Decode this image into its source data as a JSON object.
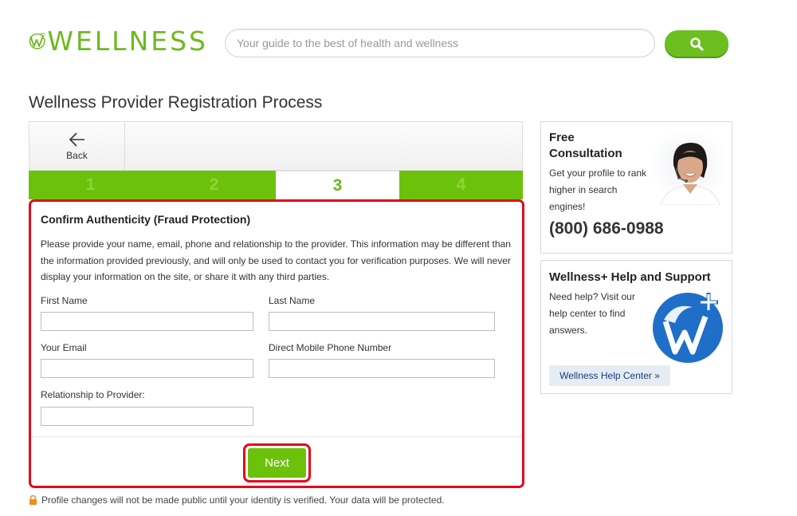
{
  "header": {
    "logo_text": "WELLNESS",
    "search": {
      "placeholder": "Your guide to the best of health and wellness",
      "value": ""
    },
    "search_icon": "search-icon"
  },
  "page_title": "Wellness Provider Registration Process",
  "nav": {
    "back_label": "Back",
    "back_icon": "arrow-left-icon"
  },
  "steps": [
    {
      "label": "1",
      "active": false
    },
    {
      "label": "2",
      "active": false
    },
    {
      "label": "3",
      "active": true
    },
    {
      "label": "4",
      "active": false
    }
  ],
  "form": {
    "title": "Confirm Authenticity (Fraud Protection)",
    "description": "Please provide your name, email, phone and relationship to the provider. This information may be different than the information provided previously, and will only be used to contact you for verification purposes. We will never display your information on the site, or share it with any third parties.",
    "fields": {
      "first_name": {
        "label": "First Name",
        "value": ""
      },
      "last_name": {
        "label": "Last Name",
        "value": ""
      },
      "email": {
        "label": "Your Email",
        "value": ""
      },
      "phone": {
        "label": "Direct Mobile Phone Number",
        "value": ""
      },
      "relationship": {
        "label": "Relationship to Provider:",
        "value": ""
      }
    },
    "next_label": "Next"
  },
  "privacy_note": "Profile changes will not be made public until your identity is verified. Your data will be protected.",
  "sidebar": {
    "consultation": {
      "title": "Free Consultation",
      "text": "Get your profile to rank higher in search engines!",
      "phone": "(800) 686-0988"
    },
    "help": {
      "title": "Wellness+ Help and Support",
      "text": "Need help? Visit our help center to find answers.",
      "button_label": "Wellness Help Center  »"
    }
  },
  "colors": {
    "brand_green": "#6cc20a",
    "highlight_red": "#e3061a",
    "help_blue": "#1f6fc9"
  }
}
